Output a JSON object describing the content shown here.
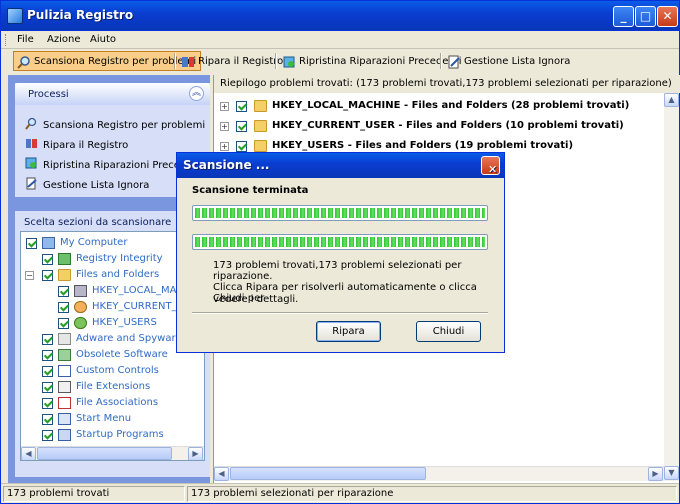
{
  "window": {
    "title": "Pulizia Registro"
  },
  "menu": [
    "File",
    "Azione",
    "Aiuto"
  ],
  "toolbar": {
    "scan": "Scansiona Registro per problemi",
    "repair": "Ripara il Registro",
    "restore": "Ripristina Riparazioni Precedenti",
    "ignore": "Gestione Lista Ignora"
  },
  "processes": {
    "title": "Processi",
    "items": [
      "Scansiona Registro per problemi",
      "Ripara il Registro",
      "Ripristina Riparazioni Precedenti",
      "Gestione Lista Ignora"
    ]
  },
  "sections": {
    "title": "Scelta sezioni da scansionare",
    "items": [
      "My Computer",
      "Registry Integrity",
      "Files and Folders",
      "HKEY_LOCAL_MACHINE",
      "HKEY_CURRENT_USER",
      "HKEY_USERS",
      "Adware and Spyware",
      "Obsolete Software",
      "Custom Controls",
      "File Extensions",
      "File Associations",
      "Start Menu",
      "Startup Programs"
    ]
  },
  "summary": {
    "header": "Riepilogo problemi trovati: (173 problemi trovati,173 problemi selezionati per riparazione)",
    "rows": [
      "HKEY_LOCAL_MACHINE - Files and Folders  (28 problemi trovati)",
      "HKEY_CURRENT_USER - Files and Folders  (10 problemi trovati)",
      "HKEY_USERS - Files and Folders  (19 problemi trovati)"
    ]
  },
  "status": {
    "left": "173 problemi trovati",
    "right": "173 problemi selezionati per riparazione"
  },
  "dialog": {
    "title": "Scansione ...",
    "headline": "Scansione terminata",
    "progress": [
      1.0,
      1.0
    ],
    "result": "173 problemi trovati,173 problemi selezionati per riparazione.",
    "hint_line1": "Clicca Ripara per risolverli automaticamente o clicca Chiudi per",
    "hint_line2": "vedere i dettagli.",
    "repair_label": "Ripara",
    "close_label": "Chiudi"
  },
  "colors": {
    "accent": "#0a3cd0",
    "tree_text": "#316ac5",
    "check": "#21a121"
  },
  "icons": {
    "close": "close-icon",
    "minimize": "minimize-icon",
    "maximize": "maximize-icon"
  }
}
